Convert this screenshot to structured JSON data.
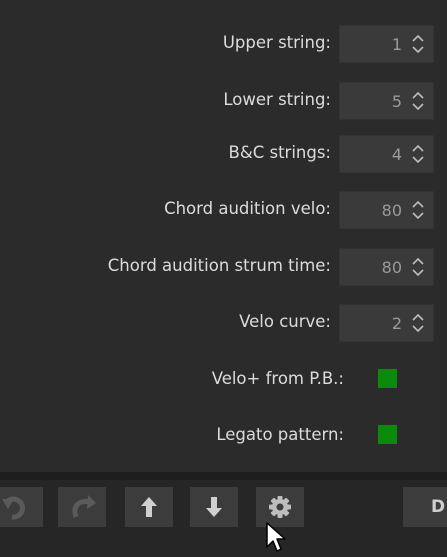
{
  "settings": [
    {
      "label": "Upper string:",
      "value": "1"
    },
    {
      "label": "Lower string:",
      "value": "5"
    },
    {
      "label": "B&C strings:",
      "value": "4"
    },
    {
      "label": "Chord audition velo:",
      "value": "80"
    },
    {
      "label": "Chord audition strum time:",
      "value": "80"
    },
    {
      "label": "Velo curve:",
      "value": "2"
    }
  ],
  "checkboxes": [
    {
      "label": "Velo+ from P.B.:",
      "checked": true
    },
    {
      "label": "Legato pattern:",
      "checked": true
    }
  ],
  "toolbar": {
    "buttons": [
      "undo-icon",
      "redo-icon",
      "arrow-up-icon",
      "arrow-down-icon",
      "gear-icon"
    ],
    "partial_label": "D"
  },
  "colors": {
    "background": "#2b2b2b",
    "field": "#3a3a3a",
    "checkbox_on": "#0b8a0b",
    "toolbar_button": "#3c3c3c"
  }
}
